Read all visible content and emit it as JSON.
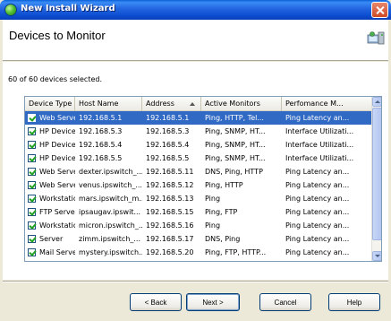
{
  "window": {
    "title": "New Install Wizard"
  },
  "header": {
    "title": "Devices to Monitor",
    "icon": "devices-icon"
  },
  "status": {
    "selected_text": "60 of 60 devices selected."
  },
  "table": {
    "columns": [
      "Device Type",
      "Host Name",
      "Address",
      "Active Monitors",
      "Perfomance M..."
    ],
    "sorted_column": "Address",
    "rows": [
      {
        "checked": true,
        "type": "Web Server",
        "host": "192.168.5.1",
        "address": "192.168.5.1",
        "monitors": "Ping, HTTP, Tel...",
        "perf": "Ping Latency an...",
        "selected": true
      },
      {
        "checked": true,
        "type": "HP Device",
        "host": "192.168.5.3",
        "address": "192.168.5.3",
        "monitors": "Ping, SNMP, HT...",
        "perf": "Interface Utilizati..."
      },
      {
        "checked": true,
        "type": "HP Device",
        "host": "192.168.5.4",
        "address": "192.168.5.4",
        "monitors": "Ping, SNMP, HT...",
        "perf": "Interface Utilizati..."
      },
      {
        "checked": true,
        "type": "HP Device",
        "host": "192.168.5.5",
        "address": "192.168.5.5",
        "monitors": "Ping, SNMP, HT...",
        "perf": "Interface Utilizati..."
      },
      {
        "checked": true,
        "type": "Web Server",
        "host": "dexter.ipswitch_...",
        "address": "192.168.5.11",
        "monitors": "DNS, Ping, HTTP",
        "perf": "Ping Latency an..."
      },
      {
        "checked": true,
        "type": "Web Server",
        "host": "venus.ipswitch_...",
        "address": "192.168.5.12",
        "monitors": "Ping, HTTP",
        "perf": "Ping Latency an..."
      },
      {
        "checked": true,
        "type": "Workstation",
        "host": "mars.ipswitch_m...",
        "address": "192.168.5.13",
        "monitors": "Ping",
        "perf": "Ping Latency an..."
      },
      {
        "checked": true,
        "type": "FTP Server",
        "host": "ipsaugav.ipswit...",
        "address": "192.168.5.15",
        "monitors": "Ping, FTP",
        "perf": "Ping Latency an..."
      },
      {
        "checked": true,
        "type": "Workstation",
        "host": "micron.ipswitch_...",
        "address": "192.168.5.16",
        "monitors": "Ping",
        "perf": "Ping Latency an..."
      },
      {
        "checked": true,
        "type": "Server",
        "host": "zimm.ipswitch_...",
        "address": "192.168.5.17",
        "monitors": "DNS, Ping",
        "perf": "Ping Latency an..."
      },
      {
        "checked": true,
        "type": "Mail Server",
        "host": "mystery.ipswitch...",
        "address": "192.168.5.20",
        "monitors": "Ping, FTP, HTTP...",
        "perf": "Ping Latency an..."
      }
    ]
  },
  "buttons": {
    "back": "< Back",
    "next": "Next >",
    "cancel": "Cancel",
    "help": "Help"
  },
  "colors": {
    "titlebar": "#2265e0",
    "selection": "#316ac5",
    "dialog_bg": "#ece9d8"
  }
}
